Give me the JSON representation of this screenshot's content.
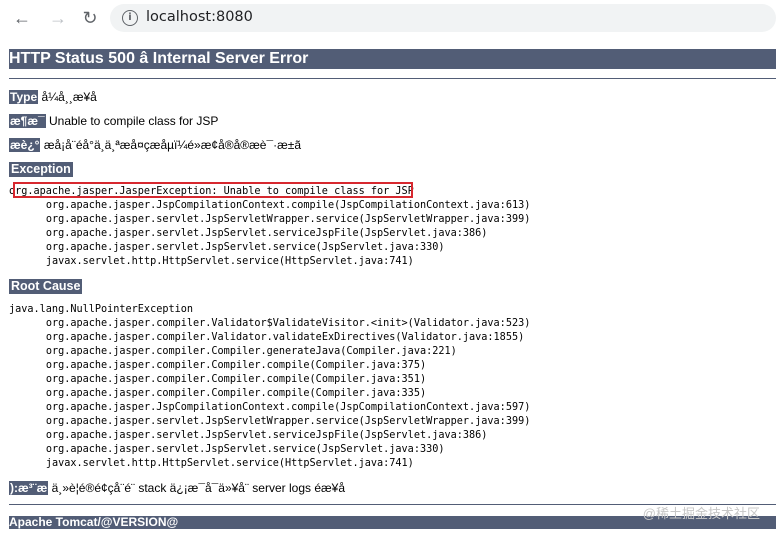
{
  "browser": {
    "url": "localhost:8080",
    "back_icon": "←",
    "forward_icon": "→",
    "reload_icon": "↻",
    "info_icon": "i"
  },
  "page": {
    "title": "HTTP Status 500 â Internal Server Error",
    "type_label": "Type",
    "type_value": "å¼å¸¸æ¥å",
    "message_label": "æ¶æ¯",
    "message_value": "Unable to compile class for JSP",
    "description_label": "æè¿°",
    "description_value": "æå¡å¨éå°ä¸ä¸ªæå¤çæåµï¼é»æ­¢å®å®æè¯·æ±ã",
    "exception_header": "Exception",
    "exception_trace": "org.apache.jasper.JasperException: Unable to compile class for JSP\n\torg.apache.jasper.JspCompilationContext.compile(JspCompilationContext.java:613)\n\torg.apache.jasper.servlet.JspServletWrapper.service(JspServletWrapper.java:399)\n\torg.apache.jasper.servlet.JspServlet.serviceJspFile(JspServlet.java:386)\n\torg.apache.jasper.servlet.JspServlet.service(JspServlet.java:330)\n\tjavax.servlet.http.HttpServlet.service(HttpServlet.java:741)",
    "root_cause_header": "Root Cause",
    "root_cause_trace": "java.lang.NullPointerException\n\torg.apache.jasper.compiler.Validator$ValidateVisitor.<init>(Validator.java:523)\n\torg.apache.jasper.compiler.Validator.validateExDirectives(Validator.java:1855)\n\torg.apache.jasper.compiler.Compiler.generateJava(Compiler.java:221)\n\torg.apache.jasper.compiler.Compiler.compile(Compiler.java:375)\n\torg.apache.jasper.compiler.Compiler.compile(Compiler.java:351)\n\torg.apache.jasper.compiler.Compiler.compile(Compiler.java:335)\n\torg.apache.jasper.JspCompilationContext.compile(JspCompilationContext.java:597)\n\torg.apache.jasper.servlet.JspServletWrapper.service(JspServletWrapper.java:399)\n\torg.apache.jasper.servlet.JspServlet.serviceJspFile(JspServlet.java:386)\n\torg.apache.jasper.servlet.JspServlet.service(JspServlet.java:330)\n\tjavax.servlet.http.HttpServlet.service(HttpServlet.java:741)",
    "note_label": "):æ³¨æ",
    "note_value": "ä¸»è¦é®é¢çå¨é¨ stack ä¿¡æ¯å¯ä»¥å¨ server logs éæ¥å",
    "footer": "Apache Tomcat/@VERSION@"
  },
  "watermark": "@稀土掘金技术社区",
  "colors": {
    "header_bg": "#525D76",
    "highlight_border": "#d7282f"
  }
}
